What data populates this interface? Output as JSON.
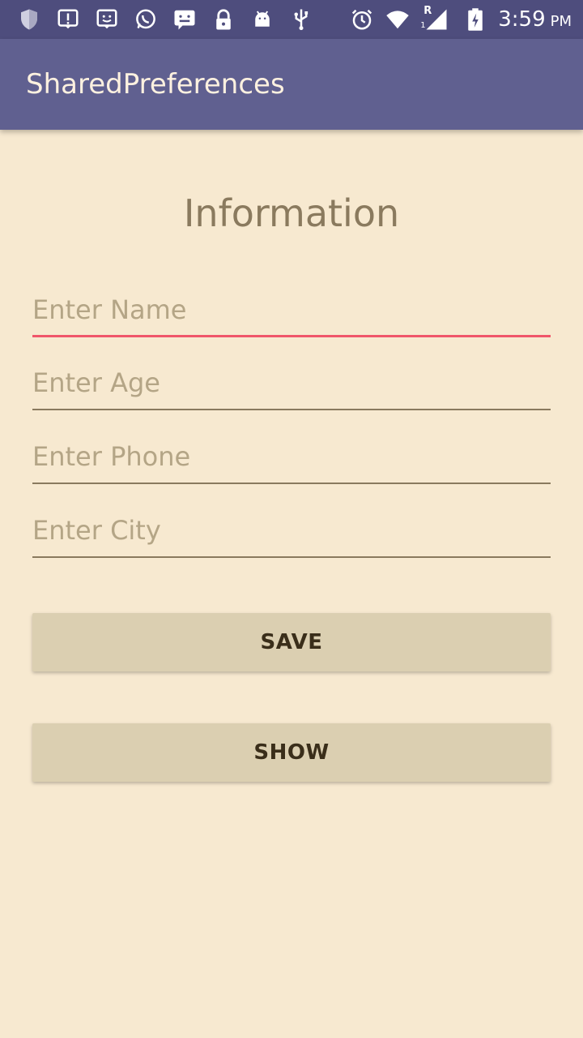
{
  "status_bar": {
    "time": "3:59",
    "ampm": "PM",
    "network_label": "R",
    "sim_number": "1",
    "icons": [
      "shield-icon",
      "alert-icon",
      "face-icon",
      "whatsapp-icon",
      "message-icon",
      "lock-icon",
      "android-icon",
      "usb-icon",
      "alarm-icon",
      "wifi-icon",
      "signal-icon",
      "battery-icon"
    ]
  },
  "app_bar": {
    "title": "SharedPreferences"
  },
  "form": {
    "heading": "Information",
    "name_placeholder": "Enter Name",
    "age_placeholder": "Enter Age",
    "phone_placeholder": "Enter Phone",
    "city_placeholder": "Enter City"
  },
  "buttons": {
    "save_label": "SAVE",
    "show_label": "SHOW"
  },
  "colors": {
    "status_bar": "#4e4d7d",
    "app_bar": "#606090",
    "background": "#f7e9d0",
    "focus_underline": "#f0566a",
    "button": "#dbcfb1"
  }
}
